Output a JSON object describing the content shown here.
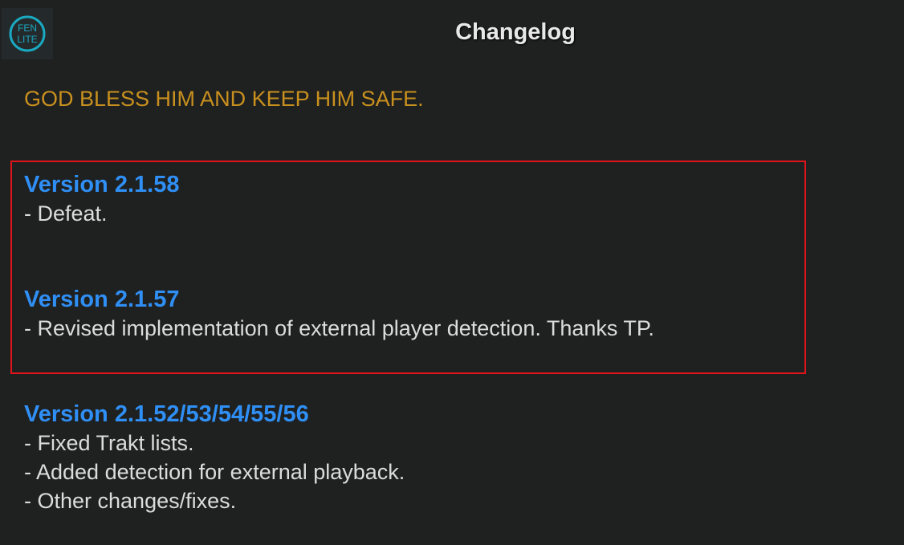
{
  "header": {
    "logo": {
      "line1": "FEN",
      "line2": "LITE",
      "ring_color": "#1aa9c2"
    },
    "title": "Changelog"
  },
  "motto": "GOD BLESS HIM AND KEEP HIM SAFE.",
  "versions": [
    {
      "title": "Version 2.1.58",
      "entries": [
        "- Defeat."
      ]
    },
    {
      "title": "Version 2.1.57",
      "entries": [
        "- Revised implementation of external player detection. Thanks TP."
      ]
    },
    {
      "title": "Version 2.1.52/53/54/55/56",
      "entries": [
        "- Fixed Trakt lists.",
        "- Added detection for external playback.",
        "- Other changes/fixes."
      ]
    }
  ],
  "colors": {
    "background": "#1f2020",
    "motto": "#c8901e",
    "version_title": "#2f8ff5",
    "entry_text": "#dcdcdc",
    "highlight_border": "#e0141a"
  }
}
